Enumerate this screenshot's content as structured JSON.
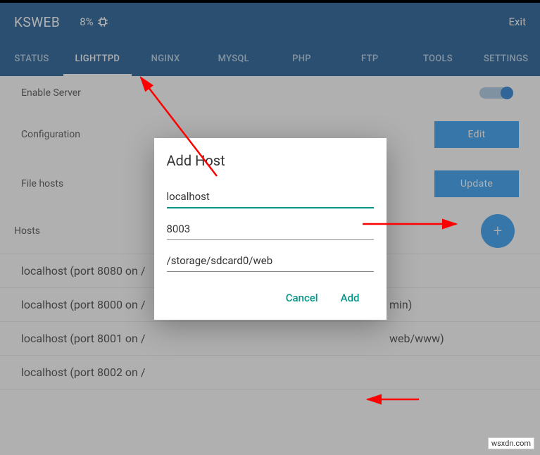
{
  "header": {
    "app_name": "KSWEB",
    "cpu_percent": "8%",
    "exit_label": "Exit"
  },
  "tabs": {
    "items": [
      {
        "label": "STATUS"
      },
      {
        "label": "LIGHTTPD"
      },
      {
        "label": "NGINX"
      },
      {
        "label": "MYSQL"
      },
      {
        "label": "PHP"
      },
      {
        "label": "FTP"
      },
      {
        "label": "TOOLS"
      },
      {
        "label": "SETTINGS"
      }
    ],
    "active_index": 1
  },
  "rows": {
    "enable_server_label": "Enable Server",
    "configuration_label": "Configuration",
    "edit_button": "Edit",
    "file_hosts_label": "File hosts",
    "update_button": "Update",
    "hosts_label": "Hosts",
    "add_icon": "+"
  },
  "hosts": [
    {
      "text": "localhost (port 8080 on /"
    },
    {
      "text": "localhost (port 8000 on /",
      "suffix": "min)"
    },
    {
      "text": "localhost (port 8001 on /",
      "suffix": "web/www)"
    },
    {
      "text": "localhost (port 8002 on /"
    }
  ],
  "dialog": {
    "title": "Add Host",
    "hostname": "localhost",
    "port": "8003",
    "path": "/storage/sdcard0/web",
    "cancel_label": "Cancel",
    "add_label": "Add"
  },
  "watermark": "wsxdn.com"
}
